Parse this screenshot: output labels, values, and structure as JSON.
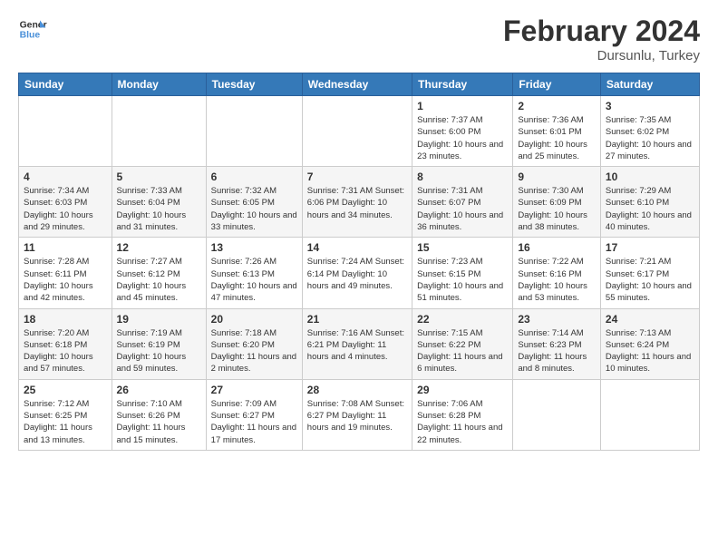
{
  "logo": {
    "line1": "General",
    "line2": "Blue"
  },
  "title": "February 2024",
  "subtitle": "Dursunlu, Turkey",
  "headers": [
    "Sunday",
    "Monday",
    "Tuesday",
    "Wednesday",
    "Thursday",
    "Friday",
    "Saturday"
  ],
  "weeks": [
    [
      {
        "day": "",
        "info": ""
      },
      {
        "day": "",
        "info": ""
      },
      {
        "day": "",
        "info": ""
      },
      {
        "day": "",
        "info": ""
      },
      {
        "day": "1",
        "info": "Sunrise: 7:37 AM\nSunset: 6:00 PM\nDaylight: 10 hours\nand 23 minutes."
      },
      {
        "day": "2",
        "info": "Sunrise: 7:36 AM\nSunset: 6:01 PM\nDaylight: 10 hours\nand 25 minutes."
      },
      {
        "day": "3",
        "info": "Sunrise: 7:35 AM\nSunset: 6:02 PM\nDaylight: 10 hours\nand 27 minutes."
      }
    ],
    [
      {
        "day": "4",
        "info": "Sunrise: 7:34 AM\nSunset: 6:03 PM\nDaylight: 10 hours\nand 29 minutes."
      },
      {
        "day": "5",
        "info": "Sunrise: 7:33 AM\nSunset: 6:04 PM\nDaylight: 10 hours\nand 31 minutes."
      },
      {
        "day": "6",
        "info": "Sunrise: 7:32 AM\nSunset: 6:05 PM\nDaylight: 10 hours\nand 33 minutes."
      },
      {
        "day": "7",
        "info": "Sunrise: 7:31 AM\nSunset: 6:06 PM\nDaylight: 10 hours\nand 34 minutes."
      },
      {
        "day": "8",
        "info": "Sunrise: 7:31 AM\nSunset: 6:07 PM\nDaylight: 10 hours\nand 36 minutes."
      },
      {
        "day": "9",
        "info": "Sunrise: 7:30 AM\nSunset: 6:09 PM\nDaylight: 10 hours\nand 38 minutes."
      },
      {
        "day": "10",
        "info": "Sunrise: 7:29 AM\nSunset: 6:10 PM\nDaylight: 10 hours\nand 40 minutes."
      }
    ],
    [
      {
        "day": "11",
        "info": "Sunrise: 7:28 AM\nSunset: 6:11 PM\nDaylight: 10 hours\nand 42 minutes."
      },
      {
        "day": "12",
        "info": "Sunrise: 7:27 AM\nSunset: 6:12 PM\nDaylight: 10 hours\nand 45 minutes."
      },
      {
        "day": "13",
        "info": "Sunrise: 7:26 AM\nSunset: 6:13 PM\nDaylight: 10 hours\nand 47 minutes."
      },
      {
        "day": "14",
        "info": "Sunrise: 7:24 AM\nSunset: 6:14 PM\nDaylight: 10 hours\nand 49 minutes."
      },
      {
        "day": "15",
        "info": "Sunrise: 7:23 AM\nSunset: 6:15 PM\nDaylight: 10 hours\nand 51 minutes."
      },
      {
        "day": "16",
        "info": "Sunrise: 7:22 AM\nSunset: 6:16 PM\nDaylight: 10 hours\nand 53 minutes."
      },
      {
        "day": "17",
        "info": "Sunrise: 7:21 AM\nSunset: 6:17 PM\nDaylight: 10 hours\nand 55 minutes."
      }
    ],
    [
      {
        "day": "18",
        "info": "Sunrise: 7:20 AM\nSunset: 6:18 PM\nDaylight: 10 hours\nand 57 minutes."
      },
      {
        "day": "19",
        "info": "Sunrise: 7:19 AM\nSunset: 6:19 PM\nDaylight: 10 hours\nand 59 minutes."
      },
      {
        "day": "20",
        "info": "Sunrise: 7:18 AM\nSunset: 6:20 PM\nDaylight: 11 hours\nand 2 minutes."
      },
      {
        "day": "21",
        "info": "Sunrise: 7:16 AM\nSunset: 6:21 PM\nDaylight: 11 hours\nand 4 minutes."
      },
      {
        "day": "22",
        "info": "Sunrise: 7:15 AM\nSunset: 6:22 PM\nDaylight: 11 hours\nand 6 minutes."
      },
      {
        "day": "23",
        "info": "Sunrise: 7:14 AM\nSunset: 6:23 PM\nDaylight: 11 hours\nand 8 minutes."
      },
      {
        "day": "24",
        "info": "Sunrise: 7:13 AM\nSunset: 6:24 PM\nDaylight: 11 hours\nand 10 minutes."
      }
    ],
    [
      {
        "day": "25",
        "info": "Sunrise: 7:12 AM\nSunset: 6:25 PM\nDaylight: 11 hours\nand 13 minutes."
      },
      {
        "day": "26",
        "info": "Sunrise: 7:10 AM\nSunset: 6:26 PM\nDaylight: 11 hours\nand 15 minutes."
      },
      {
        "day": "27",
        "info": "Sunrise: 7:09 AM\nSunset: 6:27 PM\nDaylight: 11 hours\nand 17 minutes."
      },
      {
        "day": "28",
        "info": "Sunrise: 7:08 AM\nSunset: 6:27 PM\nDaylight: 11 hours\nand 19 minutes."
      },
      {
        "day": "29",
        "info": "Sunrise: 7:06 AM\nSunset: 6:28 PM\nDaylight: 11 hours\nand 22 minutes."
      },
      {
        "day": "",
        "info": ""
      },
      {
        "day": "",
        "info": ""
      }
    ]
  ]
}
